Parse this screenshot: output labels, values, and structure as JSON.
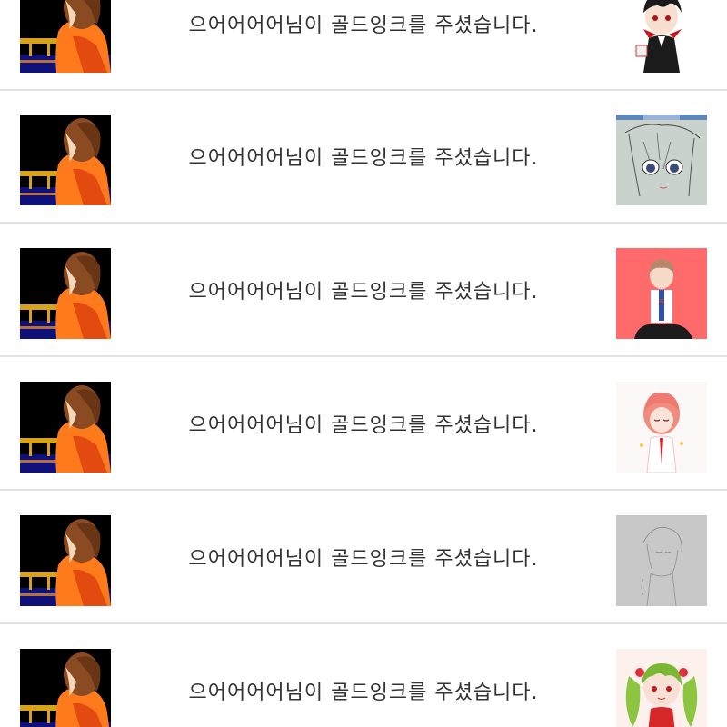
{
  "notifications": [
    {
      "message": "으어어어어님이 골드잉크를 주셨습니다.",
      "sender_avatar": "night-bridge-girl-avatar",
      "artwork": "vampire-boy-chibi-art",
      "artwork_bg": "#ffffff"
    },
    {
      "message": "으어어어어님이 골드잉크를 주셨습니다.",
      "sender_avatar": "night-bridge-girl-avatar",
      "artwork": "pencil-sketch-girl-art",
      "artwork_bg": "#c9d2cd"
    },
    {
      "message": "으어어어어님이 골드잉크를 주셨습니다.",
      "sender_avatar": "night-bridge-girl-avatar",
      "artwork": "boy-on-red-background-art",
      "artwork_bg": "#ff6b6b"
    },
    {
      "message": "으어어어어님이 골드잉크를 주셨습니다.",
      "sender_avatar": "night-bridge-girl-avatar",
      "artwork": "pink-haired-girl-art",
      "artwork_bg": "#fdf8f8"
    },
    {
      "message": "으어어어어님이 골드잉크를 주셨습니다.",
      "sender_avatar": "night-bridge-girl-avatar",
      "artwork": "gray-sketch-art",
      "artwork_bg": "#c8c8c8"
    },
    {
      "message": "으어어어어님이 골드잉크를 주셨습니다.",
      "sender_avatar": "night-bridge-girl-avatar",
      "artwork": "green-twintail-girl-art",
      "artwork_bg": "#fdf1ee"
    }
  ]
}
